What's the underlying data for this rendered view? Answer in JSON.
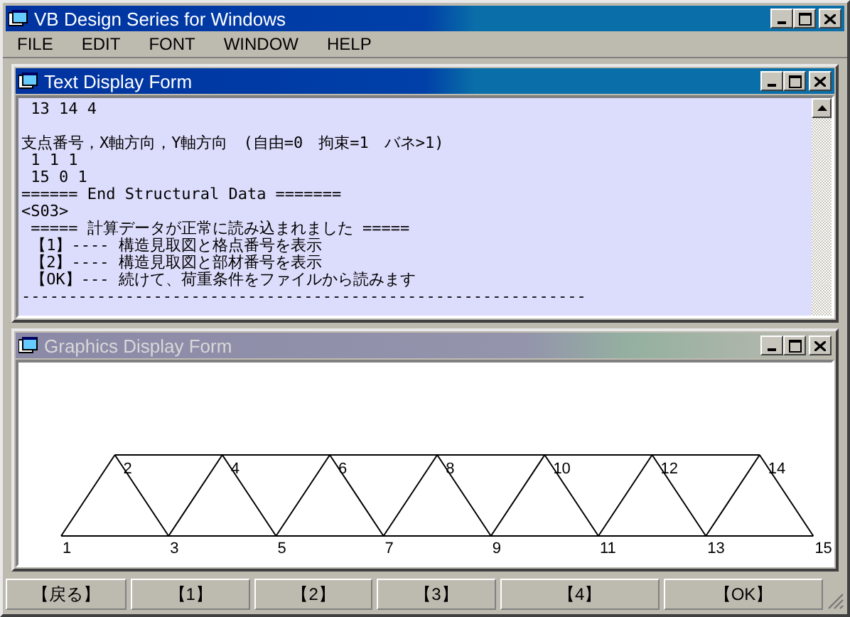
{
  "window": {
    "title": "VB Design Series for Windows"
  },
  "menu": [
    "FILE",
    "EDIT",
    "FONT",
    "WINDOW",
    "HELP"
  ],
  "text_form": {
    "title": "Text Display Form",
    "active": true,
    "paragraphs": [
      [
        " 13 14 4"
      ],
      [
        "支点番号，X軸方向，Y軸方向　(自由=0　拘束=1　バネ>1)",
        " 1 1 1",
        " 15 0 1",
        "====== End Structural Data =======",
        "<S03>",
        " ===== 計算データが正常に読み込まれました =====",
        " 【1】---- 構造見取図と格点番号を表示",
        " 【2】---- 構造見取図と部材番号を表示",
        " 【OK】--- 続けて、荷重条件をファイルから読みます",
        "------------------------------------------------------------"
      ]
    ]
  },
  "graphics_form": {
    "title": "Graphics Display Form",
    "active": false,
    "node_labels": [
      "1",
      "2",
      "3",
      "4",
      "5",
      "6",
      "7",
      "8",
      "9",
      "10",
      "11",
      "12",
      "13",
      "14",
      "15"
    ]
  },
  "status_buttons": [
    "【戻る】",
    "【1】",
    "【2】",
    "【3】",
    "【4】",
    "【OK】"
  ]
}
